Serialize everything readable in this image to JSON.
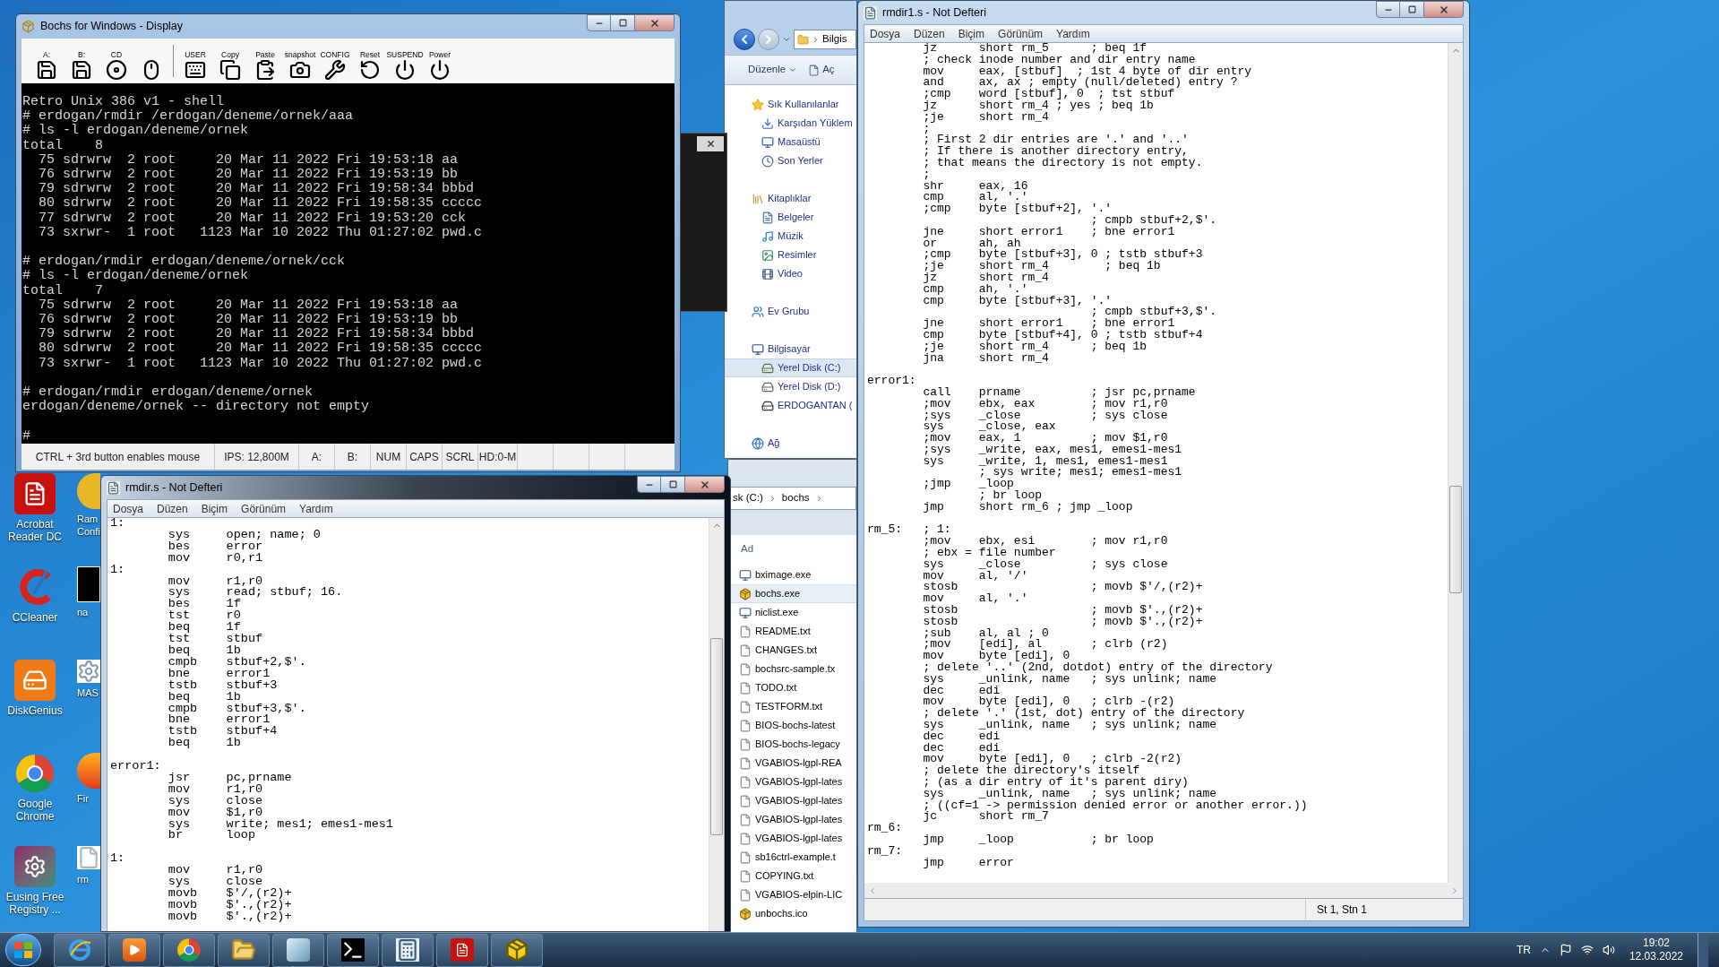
{
  "desktop": {
    "icons": [
      {
        "label": "Acrobat Reader DC",
        "kind": "acrobat"
      },
      {
        "label": "CCleaner",
        "kind": "ccleaner"
      },
      {
        "label": "DiskGenius",
        "kind": "diskgenius"
      },
      {
        "label": "Google Chrome",
        "kind": "chrome"
      },
      {
        "label": "Eusing Free Registry ...",
        "kind": "registry"
      }
    ],
    "partial_icons": [
      {
        "lines": [
          "Ram",
          "Confi"
        ],
        "kind": "sphere"
      },
      {
        "lines": [
          "na"
        ],
        "kind": "dark"
      },
      {
        "lines": [
          "MAS"
        ],
        "kind": "gear"
      },
      {
        "lines": [
          "Fir"
        ],
        "kind": "fox"
      },
      {
        "lines": [
          "rm"
        ],
        "kind": "doc"
      }
    ]
  },
  "bochs": {
    "title": "Bochs for Windows - Display",
    "toolbar": [
      {
        "label": "A:",
        "kind": "floppy"
      },
      {
        "label": "B:",
        "kind": "floppy"
      },
      {
        "label": "CD",
        "kind": "cd"
      },
      {
        "kind": "mouse"
      },
      {
        "label": "USER",
        "kind": "keyboard"
      },
      {
        "label": "Copy",
        "kind": "copy"
      },
      {
        "label": "Paste",
        "kind": "paste"
      },
      {
        "label": "snapshot",
        "kind": "camera"
      },
      {
        "label": "CONFIG",
        "kind": "config"
      },
      {
        "label": "Reset",
        "kind": "reset"
      },
      {
        "label": "SUSPEND",
        "kind": "suspend"
      },
      {
        "label": "Power",
        "kind": "power"
      }
    ],
    "screen": "Retro Unix 386 v1 - shell\n# erdogan/rmdir /erdogan/deneme/ornek/aaa\n# ls -l erdogan/deneme/ornek\ntotal    8\n  75 sdrwrw  2 root     20 Mar 11 2022 Fri 19:53:18 aa\n  76 sdrwrw  2 root     20 Mar 11 2022 Fri 19:53:19 bb\n  79 sdrwrw  2 root     20 Mar 11 2022 Fri 19:58:34 bbbd\n  80 sdrwrw  2 root     20 Mar 11 2022 Fri 19:58:35 ccccc\n  77 sdrwrw  2 root     20 Mar 11 2022 Fri 19:53:20 cck\n  73 sxrwr-  1 root   1123 Mar 10 2022 Thu 01:27:02 pwd.c\n\n# erdogan/rmdir erdogan/deneme/ornek/cck\n# ls -l erdogan/deneme/ornek\ntotal    7\n  75 sdrwrw  2 root     20 Mar 11 2022 Fri 19:53:18 aa\n  76 sdrwrw  2 root     20 Mar 11 2022 Fri 19:53:19 bb\n  79 sdrwrw  2 root     20 Mar 11 2022 Fri 19:58:34 bbbd\n  80 sdrwrw  2 root     20 Mar 11 2022 Fri 19:58:35 ccccc\n  73 sxrwr-  1 root   1123 Mar 10 2022 Thu 01:27:02 pwd.c\n\n# erdogan/rmdir erdogan/deneme/ornek\nerdogan/deneme/ornek -- directory not empty\n\n#",
    "status_bar": [
      "CTRL + 3rd button enables mouse",
      "IPS: 12,800M",
      "A:",
      "B:",
      "NUM",
      "CAPS",
      "SCRL",
      "HD:0-M"
    ]
  },
  "explorer": {
    "address": "Bilgis",
    "toolbar": [
      "Düzenle",
      "Aç"
    ],
    "sidebar": [
      {
        "label": "Sık Kullanılanlar",
        "kind": "star",
        "selected": false,
        "children": [
          {
            "label": "Karşıdan Yüklem",
            "kind": "download",
            "selected": false
          },
          {
            "label": "Masaüstü",
            "kind": "desktop",
            "selected": false
          },
          {
            "label": "Son Yerler",
            "kind": "recent",
            "selected": false
          }
        ]
      },
      {
        "label": "Kitaplıklar",
        "kind": "library",
        "selected": false,
        "children": [
          {
            "label": "Belgeler",
            "kind": "docs",
            "selected": false
          },
          {
            "label": "Müzik",
            "kind": "music",
            "selected": false
          },
          {
            "label": "Resimler",
            "kind": "pictures",
            "selected": false
          },
          {
            "label": "Video",
            "kind": "video",
            "selected": false
          }
        ]
      },
      {
        "label": "Ev Grubu",
        "kind": "homegroup",
        "selected": false
      },
      {
        "label": "Bilgisayar",
        "kind": "computer",
        "selected": false,
        "children": [
          {
            "label": "Yerel Disk (C:)",
            "kind": "sysdisk",
            "selected": true
          },
          {
            "label": "Yerel Disk (D:)",
            "kind": "disk",
            "selected": false
          },
          {
            "label": "ERDOGANTAN (",
            "kind": "drive",
            "selected": false
          }
        ]
      },
      {
        "label": "Ağ",
        "kind": "network",
        "selected": false
      }
    ]
  },
  "explorer_files": {
    "breadcrumb": [
      "sk (C:)",
      "bochs"
    ],
    "column": "Ad",
    "files": [
      {
        "name": "bximage.exe",
        "kind": "exe",
        "selected": false
      },
      {
        "name": "bochs.exe",
        "kind": "package",
        "selected": true
      },
      {
        "name": "niclist.exe",
        "kind": "exe",
        "selected": false
      },
      {
        "name": "README.txt",
        "kind": "file",
        "selected": false
      },
      {
        "name": "CHANGES.txt",
        "kind": "file",
        "selected": false
      },
      {
        "name": "bochsrc-sample.tx",
        "kind": "file",
        "selected": false
      },
      {
        "name": "TODO.txt",
        "kind": "file",
        "selected": false
      },
      {
        "name": "TESTFORM.txt",
        "kind": "file",
        "selected": false
      },
      {
        "name": "BIOS-bochs-latest",
        "kind": "file",
        "selected": false
      },
      {
        "name": "BIOS-bochs-legacy",
        "kind": "file",
        "selected": false
      },
      {
        "name": "VGABIOS-lgpl-REA",
        "kind": "file",
        "selected": false
      },
      {
        "name": "VGABIOS-lgpl-lates",
        "kind": "file",
        "selected": false
      },
      {
        "name": "VGABIOS-lgpl-lates",
        "kind": "file",
        "selected": false
      },
      {
        "name": "VGABIOS-lgpl-lates",
        "kind": "file",
        "selected": false
      },
      {
        "name": "VGABIOS-lgpl-lates",
        "kind": "file",
        "selected": false
      },
      {
        "name": "sb16ctrl-example.t",
        "kind": "file",
        "selected": false
      },
      {
        "name": "COPYING.txt",
        "kind": "file",
        "selected": false
      },
      {
        "name": "VGABIOS-elpin-LIC",
        "kind": "file",
        "selected": false
      },
      {
        "name": "unbochs.ico",
        "kind": "package",
        "selected": false
      }
    ]
  },
  "notepad_small": {
    "title": "rmdir.s - Not Defteri",
    "menu": [
      "Dosya",
      "Düzen",
      "Biçim",
      "Görünüm",
      "Yardım"
    ],
    "text": "1:\n        sys     open; name; 0\n        bes     error\n        mov     r0,r1\n1:\n        mov     r1,r0\n        sys     read; stbuf; 16.\n        bes     1f\n        tst     r0\n        beq     1f\n        tst     stbuf\n        beq     1b\n        cmpb    stbuf+2,$'.\n        bne     error1\n        tstb    stbuf+3\n        beq     1b\n        cmpb    stbuf+3,$'.\n        bne     error1\n        tstb    stbuf+4\n        beq     1b\n\nerror1:\n        jsr     pc,prname\n        mov     r1,r0\n        sys     close\n        mov     $1,r0\n        sys     write; mes1; emes1-mes1\n        br      loop\n\n1:\n        mov     r1,r0\n        sys     close\n        movb    $'/,(r2)+\n        movb    $'.,(r2)+\n        movb    $'.,(r2)+"
  },
  "notepad_big": {
    "title": "rmdir1.s - Not Defteri",
    "menu": [
      "Dosya",
      "Düzen",
      "Biçim",
      "Görünüm",
      "Yardım"
    ],
    "text": "        jz      short rm_5      ; beq 1f\n        ; check inode number and dir entry name\n        mov     eax, [stbuf]  ; 1st 4 byte of dir entry\n        and     ax, ax ; empty (null/deleted) entry ?\n        ;cmp    word [stbuf], 0  ; tst stbuf\n        jz      short rm_4 ; yes ; beq 1b\n        ;je     short rm_4\n        ;\n        ; First 2 dir entries are '.' and '..'\n        ; If there is another directory entry,\n        ; that means the directory is not empty.\n        ;\n        shr     eax, 16\n        cmp     al, '.'\n        ;cmp    byte [stbuf+2], '.'\n                                ; cmpb stbuf+2,$'.\n        jne     short error1    ; bne error1\n        or      ah, ah\n        ;cmp    byte [stbuf+3], 0 ; tstb stbuf+3\n        ;je     short rm_4        ; beq 1b\n        jz      short rm_4\n        cmp     ah, '.'\n        cmp     byte [stbuf+3], '.'\n                                ; cmpb stbuf+3,$'.\n        jne     short error1    ; bne error1\n        cmp     byte [stbuf+4], 0 ; tstb stbuf+4\n        ;je     short rm_4      ; beq 1b\n        jna     short rm_4\n\nerror1:\n        call    prname          ; jsr pc,prname\n        ;mov    ebx, eax        ; mov r1,r0\n        ;sys    _close          ; sys close\n        sys     _close, eax\n        ;mov    eax, 1          ; mov $1,r0\n        ;sys    _write, eax, mes1, emes1-mes1\n        sys     _write, 1, mes1, emes1-mes1\n                ; sys write; mes1; emes1-mes1\n        ;jmp    _loop\n                ; br loop\n        jmp     short rm_6 ; jmp _loop\n\nrm_5:   ; 1:\n        ;mov    ebx, esi        ; mov r1,r0\n        ; ebx = file number\n        sys     _close          ; sys close\n        mov     al, '/'\n        stosb                   ; movb $'/,(r2)+\n        mov     al, '.'\n        stosb                   ; movb $'.,(r2)+\n        stosb                   ; movb $'.,(r2)+\n        ;sub    al, al ; 0\n        ;mov    [edi], al       ; clrb (r2)\n        mov     byte [edi], 0\n        ; delete '..' (2nd, dotdot) entry of the directory\n        sys     _unlink, name   ; sys unlink; name\n        dec     edi\n        mov     byte [edi], 0   ; clrb -(r2)\n        ; delete '.' (1st, dot) entry of the directory\n        sys     _unlink, name   ; sys unlink; name\n        dec     edi\n        dec     edi\n        mov     byte [edi], 0   ; clrb -2(r2)\n        ; delete the directory's itself\n        ; (as a dir entry of it's parent diry)\n        sys     _unlink, name   ; sys unlink; name\n        ; ((cf=1 -> permission denied error or another error.))\n        jc      short rm_7\nrm_6:\n        jmp     _loop           ; br loop\nrm_7:\n        jmp     error",
    "status": "St 1, Stn 1"
  },
  "taskbar": {
    "apps": [
      {
        "kind": "ie"
      },
      {
        "kind": "media"
      },
      {
        "kind": "chrome"
      },
      {
        "kind": "folder"
      },
      {
        "kind": "glass"
      },
      {
        "kind": "cmd"
      },
      {
        "kind": "calc"
      },
      {
        "kind": "acrobat"
      },
      {
        "kind": "bochs"
      }
    ],
    "language": "TR",
    "time": "19:02",
    "date": "12.03.2022"
  }
}
